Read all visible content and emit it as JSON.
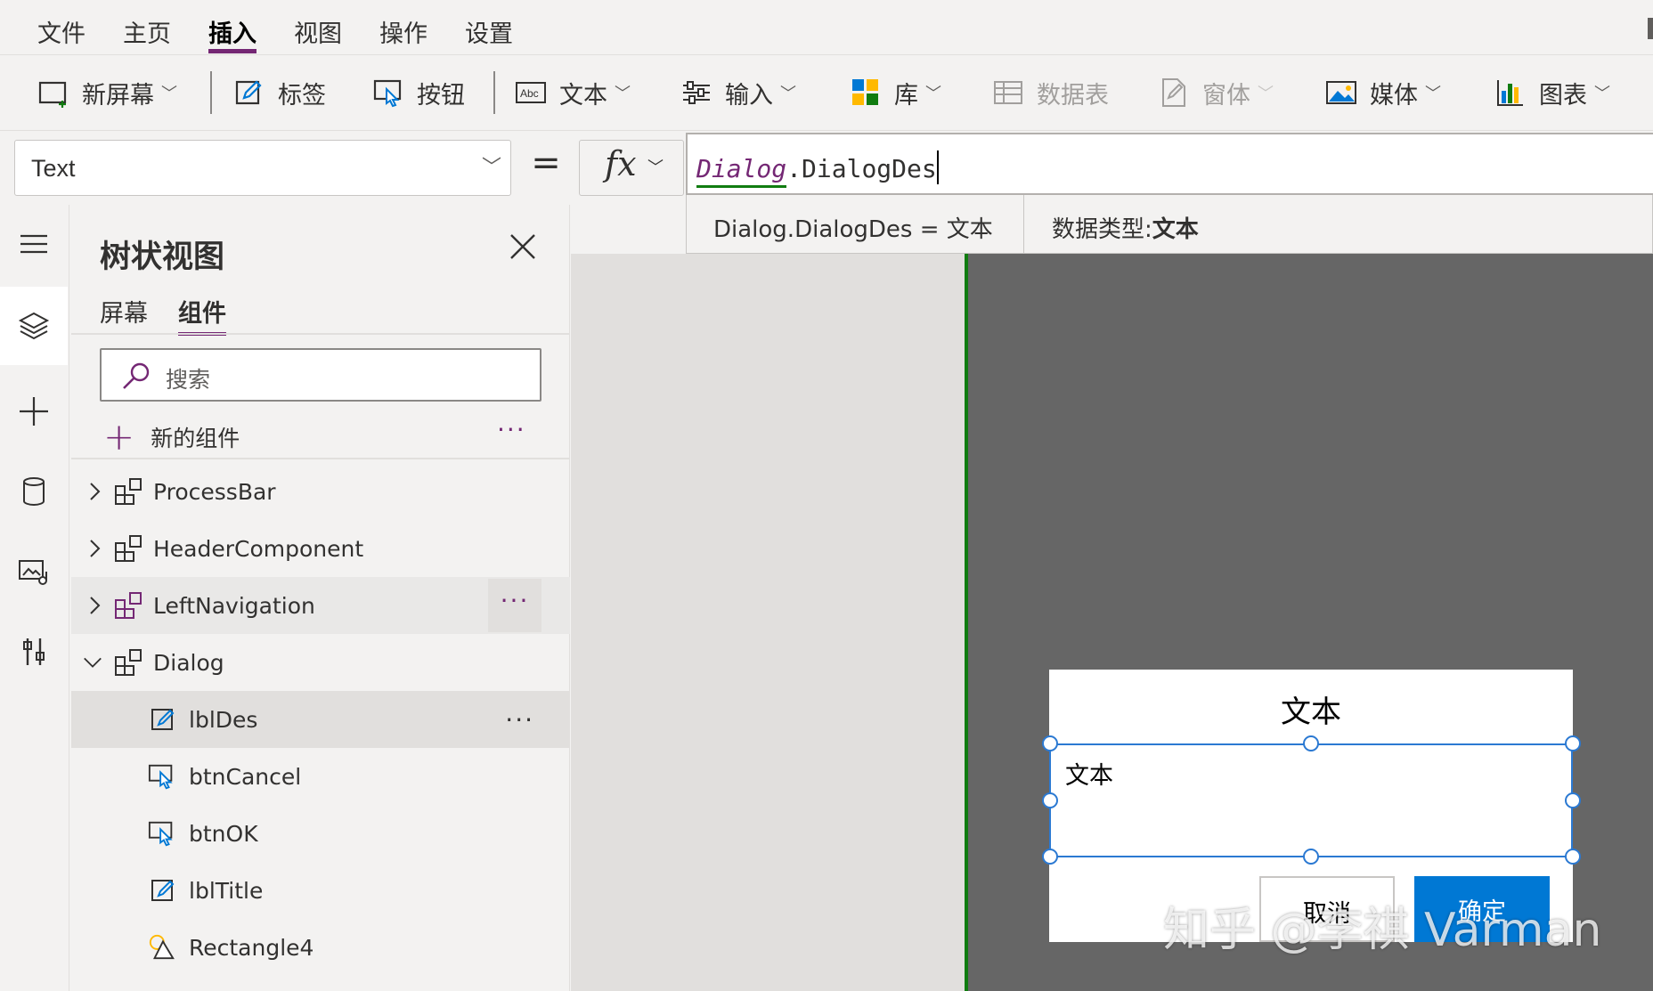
{
  "menu": {
    "items": [
      "文件",
      "主页",
      "插入",
      "视图",
      "操作",
      "设置"
    ],
    "active": "插入"
  },
  "ribbon": {
    "new_screen": "新屏幕",
    "label": "标签",
    "button": "按钮",
    "text": "文本",
    "input": "输入",
    "gallery": "库",
    "data_table": "数据表",
    "form": "窗体",
    "media": "媒体",
    "chart": "图表"
  },
  "formula_bar": {
    "property": "Text",
    "equals": "=",
    "fx": "fx",
    "formula_token": "Dialog",
    "formula_rest": ".DialogDes",
    "hint_expression": "Dialog.DialogDes  =  文本",
    "hint_type_label": "数据类型:",
    "hint_type_value": "文本"
  },
  "tree": {
    "title": "树状视图",
    "tabs": [
      "屏幕",
      "组件"
    ],
    "active_tab": "组件",
    "search_placeholder": "搜索",
    "new_component": "新的组件",
    "more": "···",
    "nodes": [
      {
        "label": "ProcessBar",
        "kind": "component",
        "expanded": false
      },
      {
        "label": "HeaderComponent",
        "kind": "component",
        "expanded": false
      },
      {
        "label": "LeftNavigation",
        "kind": "component",
        "expanded": false
      },
      {
        "label": "Dialog",
        "kind": "component",
        "expanded": true
      },
      {
        "label": "lblDes",
        "kind": "label"
      },
      {
        "label": "btnCancel",
        "kind": "button"
      },
      {
        "label": "btnOK",
        "kind": "button"
      },
      {
        "label": "lblTitle",
        "kind": "label"
      },
      {
        "label": "Rectangle4",
        "kind": "shape"
      }
    ]
  },
  "canvas": {
    "dialog_title": "文本",
    "dialog_desc": "文本",
    "cancel_label": "取消",
    "ok_label": "确定"
  },
  "watermark": "知乎 @李祺 Varman",
  "colors": {
    "accent": "#742774",
    "primary_button": "#0078d4",
    "selection": "#2b79d2",
    "canvas_edge": "#107c10"
  }
}
